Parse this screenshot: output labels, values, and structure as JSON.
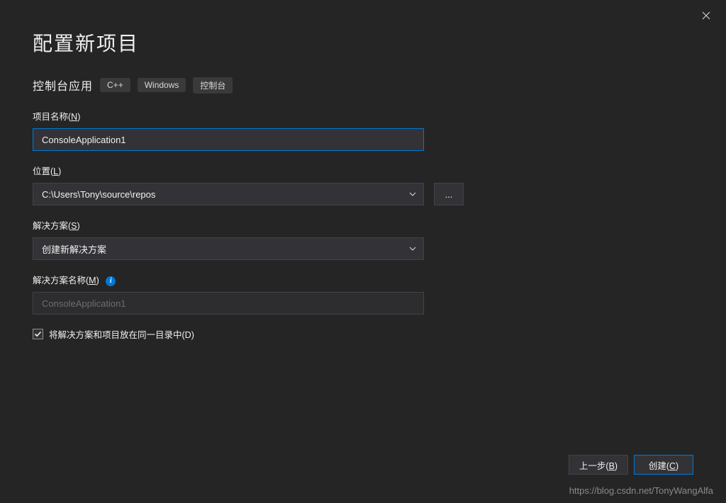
{
  "header": {
    "title": "配置新项目"
  },
  "subtitle": {
    "text": "控制台应用",
    "tags": [
      "C++",
      "Windows",
      "控制台"
    ]
  },
  "fields": {
    "projectName": {
      "label_prefix": "项目名称(",
      "label_key": "N",
      "label_suffix": ")",
      "value": "ConsoleApplication1"
    },
    "location": {
      "label_prefix": "位置(",
      "label_key": "L",
      "label_suffix": ")",
      "value": "C:\\Users\\Tony\\source\\repos",
      "browse": "..."
    },
    "solution": {
      "label_prefix": "解决方案(",
      "label_key": "S",
      "label_suffix": ")",
      "value": "创建新解决方案"
    },
    "solutionName": {
      "label_prefix": "解决方案名称(",
      "label_key": "M",
      "label_suffix": ")",
      "value": "ConsoleApplication1"
    },
    "sameDir": {
      "label_prefix": "将解决方案和项目放在同一目录中(",
      "label_key": "D",
      "label_suffix": ")",
      "checked": true
    }
  },
  "footer": {
    "back_prefix": "上一步(",
    "back_key": "B",
    "back_suffix": ")",
    "create_prefix": "创建(",
    "create_key": "C",
    "create_suffix": ")"
  },
  "watermark": "https://blog.csdn.net/TonyWangAlfa"
}
